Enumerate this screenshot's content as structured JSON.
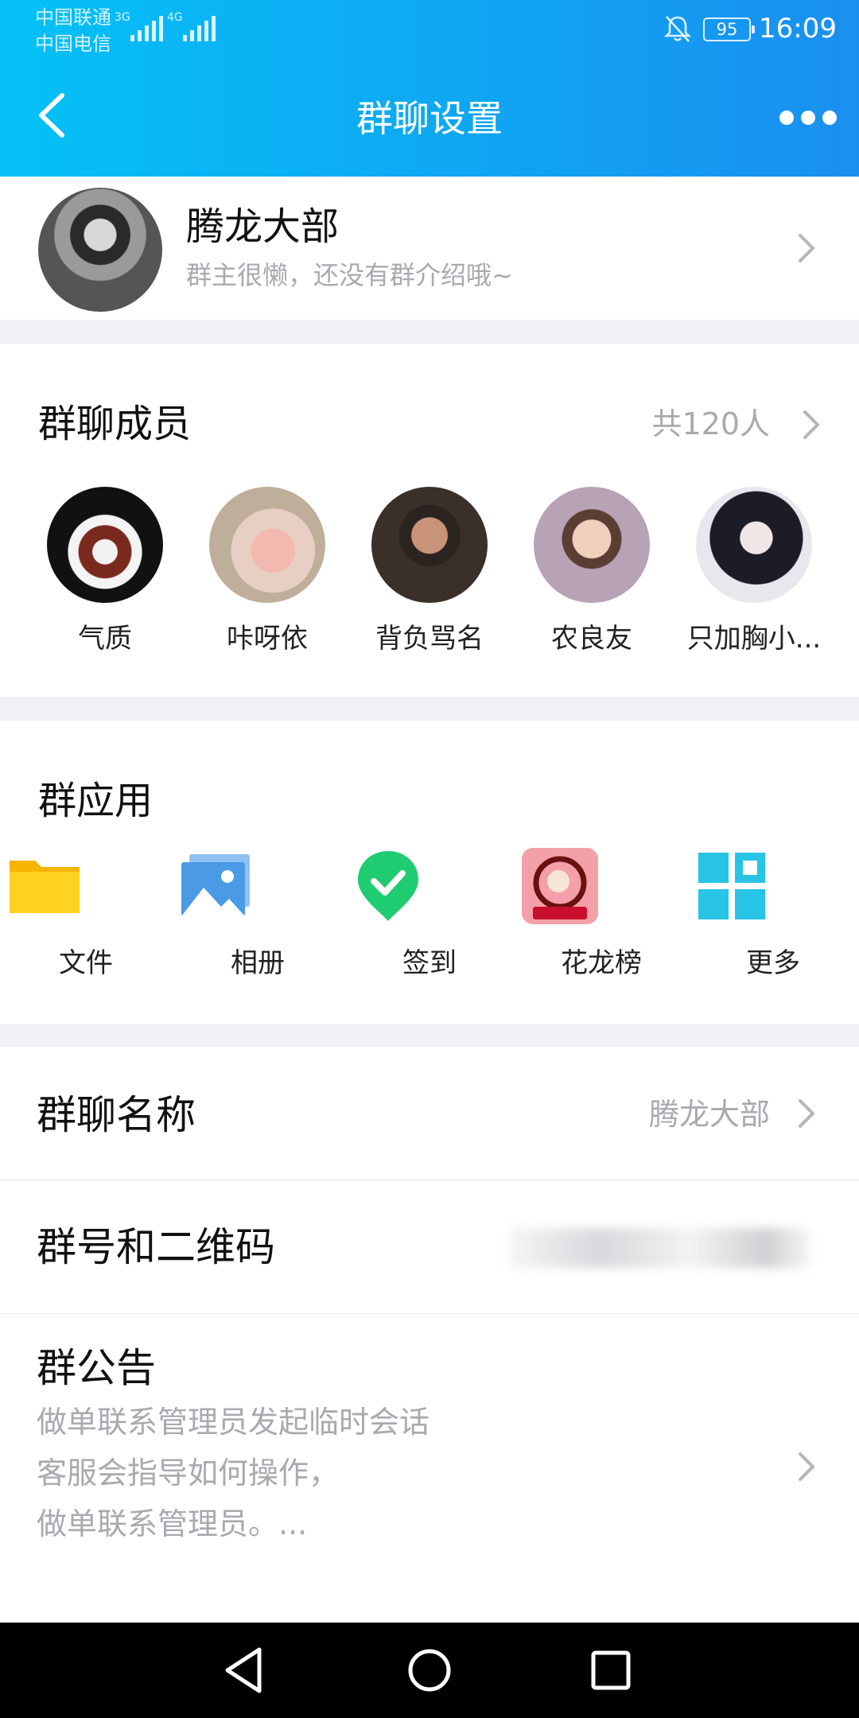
{
  "status_bar": {
    "carrier_1": "中国联通",
    "carrier_2": "中国电信",
    "net_1": "3G",
    "net_2": "4G",
    "battery": "95",
    "time": "16:09"
  },
  "nav": {
    "title": "群聊设置"
  },
  "group": {
    "name": "腾龙大部",
    "description": "群主很懒，还没有群介绍哦~"
  },
  "members": {
    "title": "群聊成员",
    "count": "共120人",
    "list": [
      {
        "name": "气质"
      },
      {
        "name": "咔呀依"
      },
      {
        "name": "背负骂名"
      },
      {
        "name": "农良友"
      },
      {
        "name": "只加胸小..."
      }
    ]
  },
  "apps": {
    "title": "群应用",
    "items": [
      {
        "label": "文件",
        "icon": "folder-icon"
      },
      {
        "label": "相册",
        "icon": "album-icon"
      },
      {
        "label": "签到",
        "icon": "checkin-icon"
      },
      {
        "label": "花龙榜",
        "icon": "dragon-rank-icon"
      },
      {
        "label": "更多",
        "icon": "more-apps-icon"
      }
    ]
  },
  "settings": {
    "name_label": "群聊名称",
    "name_value": "腾龙大部",
    "qr_label": "群号和二维码",
    "notice_label": "群公告",
    "notice_line_1": "做单联系管理员发起临时会话",
    "notice_line_2": "客服会指导如何操作，",
    "notice_line_3": "做单联系管理员。..."
  },
  "colors": {
    "header_gradient_start": "#05c1f7",
    "header_gradient_end": "#1a8ff0",
    "secondary_text": "#a9a9b0",
    "background": "#f0f0f5"
  }
}
